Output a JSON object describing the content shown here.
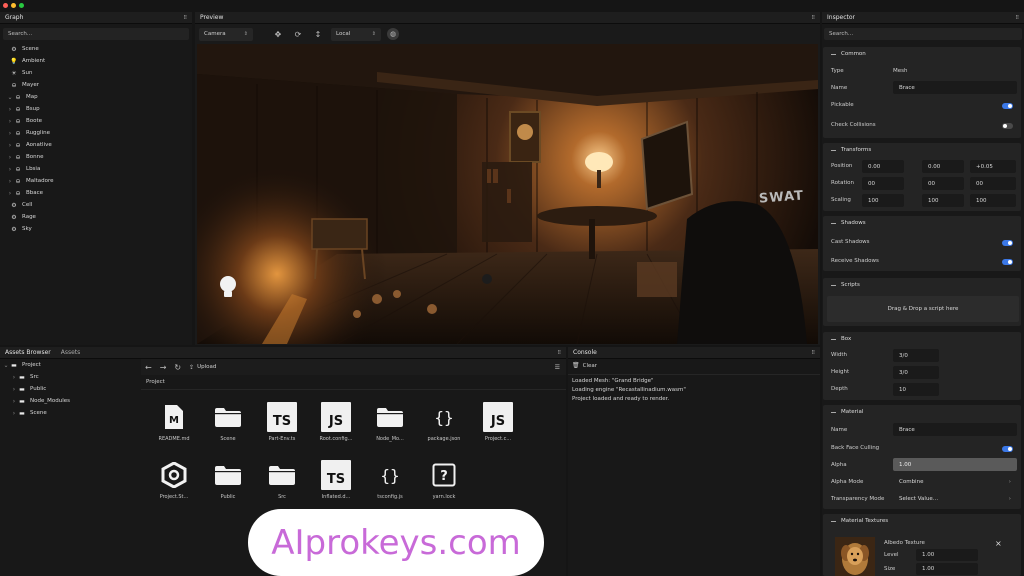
{
  "window_dots": [
    "#ff5f57",
    "#febc2e",
    "#28c840"
  ],
  "graph": {
    "tab": "Graph",
    "search_placeholder": "Search...",
    "items": [
      {
        "glyph": "⚙",
        "label": "Scene",
        "chev": ""
      },
      {
        "glyph": "💡",
        "label": "Ambient",
        "chev": ""
      },
      {
        "glyph": "☀",
        "label": "Sun",
        "chev": ""
      },
      {
        "glyph": "⊖",
        "label": "Mayer",
        "chev": ""
      },
      {
        "glyph": "⊖",
        "label": "Map",
        "chev": "⌄"
      },
      {
        "glyph": "⊖",
        "label": "Bsup",
        "chev": "›"
      },
      {
        "glyph": "⊖",
        "label": "Boote",
        "chev": "›"
      },
      {
        "glyph": "⊖",
        "label": "Ruggline",
        "chev": "›"
      },
      {
        "glyph": "⊖",
        "label": "Aonatlive",
        "chev": "›"
      },
      {
        "glyph": "⊖",
        "label": "Bonne",
        "chev": "›"
      },
      {
        "glyph": "⊖",
        "label": "Lbsia",
        "chev": "›"
      },
      {
        "glyph": "⊖",
        "label": "Maltadore",
        "chev": "›"
      },
      {
        "glyph": "⊖",
        "label": "Bbace",
        "chev": "›"
      },
      {
        "glyph": "⚙",
        "label": "Cell",
        "chev": ""
      },
      {
        "glyph": "⚙",
        "label": "Rage",
        "chev": ""
      },
      {
        "glyph": "⚙",
        "label": "Sky",
        "chev": ""
      }
    ]
  },
  "preview": {
    "tab": "Preview",
    "camera_select": "Camera",
    "space_select": "Local",
    "wall_sign": "SWAT"
  },
  "inspector": {
    "tab": "Inspector",
    "search_placeholder": "Search...",
    "common": {
      "title": "Common",
      "type_label": "Type",
      "type_value": "Mesh",
      "name_label": "Name",
      "name_value": "Brace",
      "pickable_label": "Pickable",
      "check_collisions_label": "Check Collisions"
    },
    "transforms": {
      "title": "Transforms",
      "rows": [
        {
          "label": "Position",
          "values": [
            "0.00",
            "0.00",
            "+0.05"
          ]
        },
        {
          "label": "Rotation",
          "values": [
            "00",
            "00",
            "00"
          ]
        },
        {
          "label": "Scaling",
          "values": [
            "100",
            "100",
            "100"
          ]
        }
      ]
    },
    "shadows": {
      "title": "Shadows",
      "cast_label": "Cast Shadows",
      "receive_label": "Receive Shadows"
    },
    "scripts": {
      "title": "Scripts",
      "drop_label": "Drag & Drop a script here"
    },
    "box": {
      "title": "Box",
      "rows": [
        {
          "label": "Width",
          "value": "3/0"
        },
        {
          "label": "Height",
          "value": "3/0"
        },
        {
          "label": "Depth",
          "value": "10"
        }
      ]
    },
    "material": {
      "title": "Material",
      "name_label": "Name",
      "name_value": "Brace",
      "backface_label": "Back Face Culling",
      "alpha_label": "Alpha",
      "alpha_value": "1.00",
      "alpha_mode_label": "Alpha Mode",
      "alpha_mode_value": "Combine",
      "transparency_label": "Transparency Mode",
      "transparency_value": "Select Value..."
    },
    "textures": {
      "title": "Material Textures",
      "albedo_label": "Albedo Texture",
      "rows": [
        {
          "label": "Level",
          "value": "1.00"
        },
        {
          "label": "Size",
          "value": "1.00"
        }
      ]
    }
  },
  "assets": {
    "tabs": [
      "Assets Browser",
      "Assets"
    ],
    "tree": [
      {
        "label": "Project",
        "chev": "⌄",
        "indent": 0
      },
      {
        "label": "Src",
        "chev": "›",
        "indent": 1
      },
      {
        "label": "Public",
        "chev": "›",
        "indent": 1
      },
      {
        "label": "Node_Modules",
        "chev": "›",
        "indent": 1
      },
      {
        "label": "Scene",
        "chev": "›",
        "indent": 1
      }
    ],
    "upload_label": "Upload",
    "breadcrumb": "Project",
    "files": [
      {
        "kind": "md",
        "name": "README.md"
      },
      {
        "kind": "folder",
        "name": "Scene"
      },
      {
        "kind": "ts",
        "name": "Part-Env.ts"
      },
      {
        "kind": "js",
        "name": "Root.config..."
      },
      {
        "kind": "folder",
        "name": "Node_Mo..."
      },
      {
        "kind": "braces",
        "name": "package.json"
      },
      {
        "kind": "js",
        "name": "Project.c..."
      },
      {
        "kind": "hex",
        "name": "Project.St..."
      },
      {
        "kind": "folder",
        "name": "Public"
      },
      {
        "kind": "folder",
        "name": "Src"
      },
      {
        "kind": "ts",
        "name": "Inflated.d..."
      },
      {
        "kind": "braces",
        "name": "tsconfig.js"
      },
      {
        "kind": "question",
        "name": "yarn.lock"
      }
    ]
  },
  "console": {
    "tab": "Console",
    "clear_label": "Clear",
    "lines": [
      "Loaded Mesh: \"Grand Bridge\"",
      "Loading engine \"Recastallinadium.wasm\"",
      "Project loaded and ready to render."
    ]
  },
  "watermark": "AIprokeys.com"
}
